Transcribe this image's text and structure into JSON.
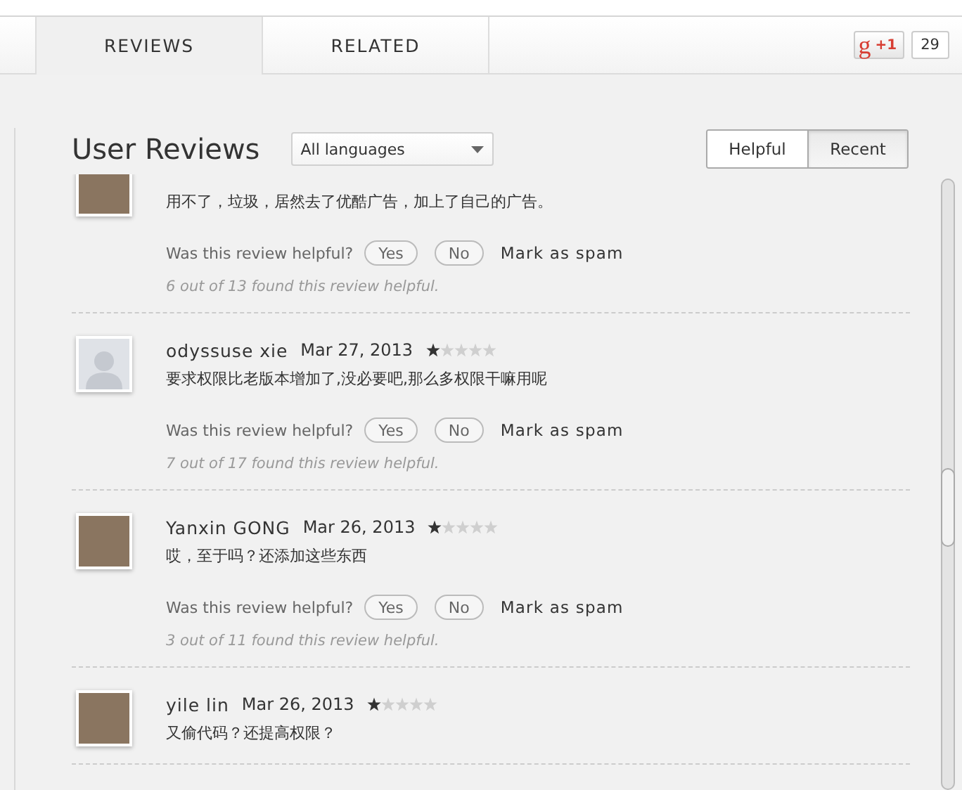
{
  "tabs": [
    {
      "label": "REVIEWS",
      "selected": true
    },
    {
      "label": "RELATED",
      "selected": false
    }
  ],
  "plus_one": {
    "logo": "g",
    "label": "+1",
    "count": "29"
  },
  "title": "User Reviews",
  "language_filter": {
    "value": "All languages"
  },
  "sort": [
    {
      "label": "Helpful",
      "selected": false
    },
    {
      "label": "Recent",
      "selected": true
    }
  ],
  "reviews": [
    {
      "kind": "photo",
      "text": "用不了，垃圾，居然去了优酷广告，加上了自己的广告。",
      "helpful_prompt": "Was this review helpful?",
      "yes": "Yes",
      "no": "No",
      "spam": "Mark as spam",
      "summary": "6 out of 13 found this review helpful."
    },
    {
      "kind": "placeholder",
      "name": "odyssuse xie",
      "date": "Mar 27, 2013",
      "stars": 1,
      "text": "要求权限比老版本增加了,没必要吧,那么多权限干嘛用呢",
      "helpful_prompt": "Was this review helpful?",
      "yes": "Yes",
      "no": "No",
      "spam": "Mark as spam",
      "summary": "7 out of 17 found this review helpful."
    },
    {
      "kind": "photo",
      "name": "Yanxin GONG",
      "date": "Mar 26, 2013",
      "stars": 1,
      "text": "哎，至于吗？还添加这些东西",
      "helpful_prompt": "Was this review helpful?",
      "yes": "Yes",
      "no": "No",
      "spam": "Mark as spam",
      "summary": "3 out of 11 found this review helpful."
    },
    {
      "kind": "photo",
      "name": "yile lin",
      "date": "Mar 26, 2013",
      "stars": 1,
      "text": "又偷代码？还提高权限？"
    }
  ]
}
